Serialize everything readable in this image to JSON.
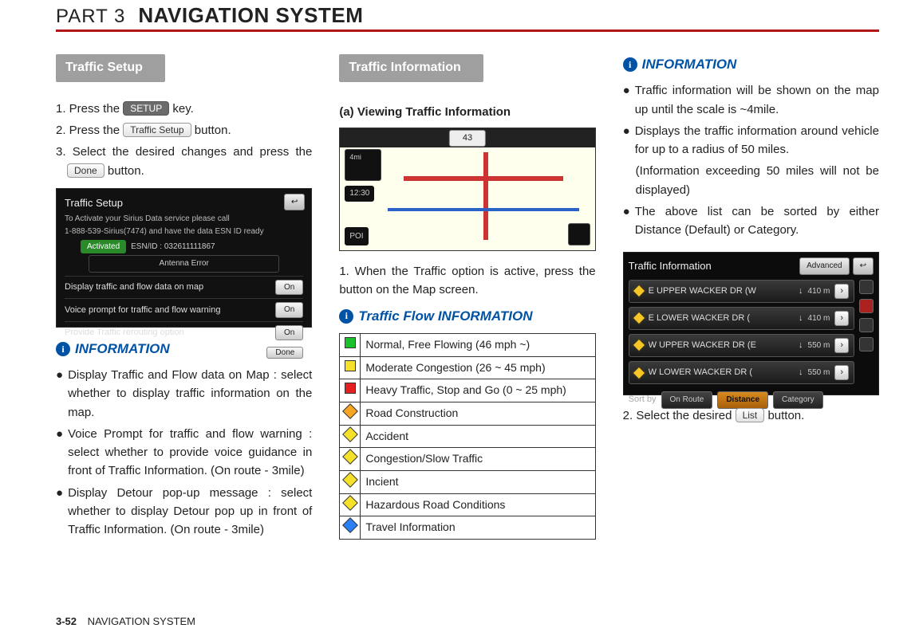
{
  "header": {
    "part": "PART 3",
    "title": "NAVIGATION SYSTEM"
  },
  "footer": {
    "page": "3-52",
    "section": "NAVIGATION SYSTEM"
  },
  "col1": {
    "section": "Traffic Setup",
    "step1_a": "1. Press the ",
    "step1_key": "SETUP",
    "step1_b": " key.",
    "step2_a": "2. Press the ",
    "step2_key": "Traffic Setup",
    "step2_b": " button.",
    "step3_a": "3. Select the desired changes and press the ",
    "step3_key": "Done",
    "step3_b": " button.",
    "screen": {
      "title": "Traffic Setup",
      "msg1": "To Activate your Sirius Data service please call",
      "msg2": "1-888-539-Sirius(7474) and have the data ESN ID ready",
      "activated": "Activated",
      "esn": "ESN/ID : 032611111867",
      "antenna": "Antenna Error",
      "rows": [
        "Display traffic and flow data on map",
        "Voice prompt for traffic and flow warning",
        "Provide Traffic rerouting option"
      ],
      "on": "On",
      "done": "Done",
      "back": "↩"
    },
    "info_label": "INFORMATION",
    "bullets": [
      "Display Traffic and Flow data on Map : select whether to display traffic information on the map.",
      "Voice Prompt for traffic and flow warning : select whether to provide voice guidance in front of Traffic Information. (On route - 3mile)",
      "Display Detour pop-up message : select whether to display Detour pop up in front of Traffic Information. (On route - 3mile)"
    ]
  },
  "col2": {
    "section": "Traffic Information",
    "sub_a": "(a) Viewing Traffic Information",
    "map": {
      "label43": "43",
      "scale": "4mi",
      "clock": "12:30",
      "poi": "POI"
    },
    "step1": "1. When the Traffic option is active, press the button on the Map screen.",
    "flow_label": "Traffic Flow INFORMATION",
    "flow_rows": [
      {
        "icon": "sq-green",
        "text": "Normal, Free Flowing (46 mph ~)"
      },
      {
        "icon": "sq-yellow",
        "text": "Moderate Congestion (26 ~ 45 mph)"
      },
      {
        "icon": "sq-red",
        "text": "Heavy Traffic, Stop and Go (0 ~ 25 mph)"
      },
      {
        "icon": "d-orange",
        "text": "Road Construction"
      },
      {
        "icon": "d-yellow",
        "text": "Accident"
      },
      {
        "icon": "d-yellow",
        "text": "Congestion/Slow Traffic"
      },
      {
        "icon": "d-yellow",
        "text": "Incient"
      },
      {
        "icon": "d-yellow",
        "text": "Hazardous Road Conditions"
      },
      {
        "icon": "d-blue",
        "text": "Travel Information"
      }
    ]
  },
  "col3": {
    "info_label": "INFORMATION",
    "bullets": [
      "Traffic information will be shown on the map up until the scale is ~4mile.",
      "Displays the traffic information around vehicle for up to a radius of 50 miles."
    ],
    "paren": "(Information exceeding 50 miles will not be displayed)",
    "bullet3": "The above list can be sorted by either Distance (Default) or Category.",
    "screen": {
      "title": "Traffic Information",
      "advanced": "Advanced",
      "rows": [
        {
          "name": "E UPPER WACKER DR (W",
          "dir": "↓",
          "dist": "410 m"
        },
        {
          "name": "E LOWER WACKER DR (",
          "dir": "↓",
          "dist": "410 m"
        },
        {
          "name": "W UPPER WACKER DR (E",
          "dir": "↓",
          "dist": "550 m"
        },
        {
          "name": "W LOWER WACKER DR (",
          "dir": "↓",
          "dist": "550 m"
        }
      ],
      "sort_label": "Sort by",
      "sort_opts": [
        "On Route",
        "Distance",
        "Category"
      ]
    },
    "step2_a": "2. Select the desired ",
    "step2_key": "List",
    "step2_b": " button."
  },
  "chart_data": {
    "type": "table",
    "title": "Traffic Flow INFORMATION",
    "rows": [
      {
        "category": "Normal, Free Flowing",
        "speed_mph": "46 ~",
        "color": "green"
      },
      {
        "category": "Moderate Congestion",
        "speed_mph": "26 ~ 45",
        "color": "yellow"
      },
      {
        "category": "Heavy Traffic, Stop and Go",
        "speed_mph": "0 ~ 25",
        "color": "red"
      },
      {
        "category": "Road Construction",
        "speed_mph": null,
        "icon": "orange-diamond"
      },
      {
        "category": "Accident",
        "speed_mph": null,
        "icon": "yellow-diamond"
      },
      {
        "category": "Congestion/Slow Traffic",
        "speed_mph": null,
        "icon": "yellow-diamond"
      },
      {
        "category": "Incient",
        "speed_mph": null,
        "icon": "yellow-diamond"
      },
      {
        "category": "Hazardous Road Conditions",
        "speed_mph": null,
        "icon": "yellow-diamond"
      },
      {
        "category": "Travel Information",
        "speed_mph": null,
        "icon": "blue-diamond"
      }
    ]
  }
}
